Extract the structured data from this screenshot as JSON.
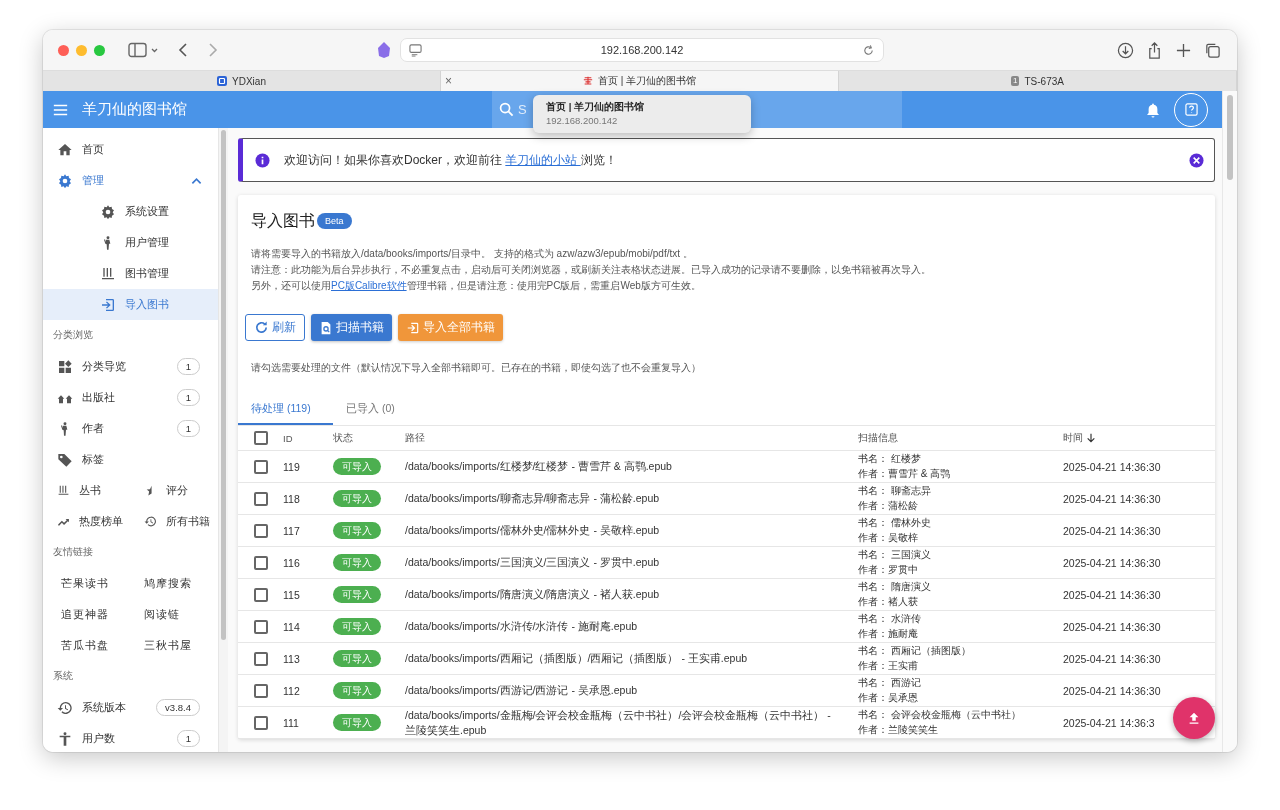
{
  "browser": {
    "address": "192.168.200.142",
    "tabs": [
      {
        "title": "YDXian",
        "selected": false
      },
      {
        "title": "首页 | 羊刀仙的图书馆",
        "selected": true,
        "close": "×"
      },
      {
        "title": "TS-673A",
        "selected": false,
        "badge": "1"
      }
    ],
    "tooltip": {
      "title": "首页 | 羊刀仙的图书馆",
      "url": "192.168.200.142"
    }
  },
  "app": {
    "title": "羊刀仙的图书馆",
    "search": {
      "placeholder": "S"
    }
  },
  "sidebar": {
    "nav": [
      {
        "label": "首页",
        "selected": false
      },
      {
        "label": "管理",
        "selected": false,
        "expanded": true,
        "children": [
          {
            "label": "系统设置",
            "selected": false
          },
          {
            "label": "用户管理",
            "selected": false
          },
          {
            "label": "图书管理",
            "selected": false
          },
          {
            "label": "导入图书",
            "selected": true
          }
        ]
      }
    ],
    "sections": [
      {
        "heading": "分类浏览",
        "items": [
          {
            "label": "分类导览",
            "count": "1"
          },
          {
            "label": "出版社",
            "count": "1"
          },
          {
            "label": "作者",
            "count": "1"
          },
          {
            "label": "标签"
          }
        ],
        "pairs": [
          "丛书",
          "评分",
          "热度榜单",
          "所有书籍"
        ]
      },
      {
        "heading": "友情链接",
        "pairs": [
          "芒果读书",
          "鸠摩搜索",
          "追更神器",
          "阅读链",
          "苦瓜书盘",
          "三秋书屋"
        ]
      },
      {
        "heading": "系统",
        "items": [
          {
            "label": "系统版本",
            "count": "v3.8.4"
          },
          {
            "label": "用户数",
            "count": "1"
          }
        ]
      }
    ]
  },
  "notice": {
    "before": "欢迎访问！如果你喜欢Docker，欢迎前往 ",
    "link": "羊刀仙的小站 ",
    "after": "浏览！"
  },
  "card": {
    "title": "导入图书",
    "badge": "Beta",
    "lines": [
      {
        "text": "请将需要导入的书籍放入/data/books/imports/目录中。 支持的格式为 azw/azw3/epub/mobi/pdf/txt 。"
      },
      {
        "text": "请注意：此功能为后台异步执行，不必重复点击，启动后可关闭浏览器，或刷新关注表格状态进展。已导入成功的记录请不要删除，以免书籍被再次导入。"
      },
      {
        "before": "另外，还可以使用",
        "link": "PC版Calibre软件",
        "after": "管理书籍，但是请注意：使用完PC版后，需重启Web版方可生效。"
      }
    ],
    "buttons": [
      {
        "label": "刷新",
        "kind": "outlined"
      },
      {
        "label": "扫描书籍",
        "kind": "primary"
      },
      {
        "label": "导入全部书籍",
        "kind": "warning"
      }
    ],
    "hint": "请勾选需要处理的文件（默认情况下导入全部书籍即可。已存在的书籍，即使勾选了也不会重复导入）",
    "tabs": [
      {
        "label": "待处理 (119)",
        "selected": true
      },
      {
        "label": "已导入 (0)",
        "selected": false
      }
    ],
    "table": {
      "all_checked": false,
      "columns": [
        "ID",
        "状态",
        "路径",
        "扫描信息",
        "时间"
      ],
      "rows": [
        {
          "checked": false,
          "id": "119",
          "status": "可导入",
          "path": "/data/books/imports/红楼梦/红楼梦 - 曹雪芹 & 高鹗.epub",
          "title_line": "书名：  红楼梦",
          "author_line": "作者：曹雪芹 & 高鹗",
          "time": "2025-04-21 14:36:30"
        },
        {
          "checked": false,
          "id": "118",
          "status": "可导入",
          "path": "/data/books/imports/聊斋志异/聊斋志异 - 蒲松龄.epub",
          "title_line": "书名：  聊斋志异",
          "author_line": "作者：蒲松龄",
          "time": "2025-04-21 14:36:30"
        },
        {
          "checked": false,
          "id": "117",
          "status": "可导入",
          "path": "/data/books/imports/儒林外史/儒林外史 - 吴敬梓.epub",
          "title_line": "书名：  儒林外史",
          "author_line": "作者：吴敬梓",
          "time": "2025-04-21 14:36:30"
        },
        {
          "checked": false,
          "id": "116",
          "status": "可导入",
          "path": "/data/books/imports/三国演义/三国演义 - 罗贯中.epub",
          "title_line": "书名：  三国演义",
          "author_line": "作者：罗贯中",
          "time": "2025-04-21 14:36:30"
        },
        {
          "checked": false,
          "id": "115",
          "status": "可导入",
          "path": "/data/books/imports/隋唐演义/隋唐演义 - 褚人获.epub",
          "title_line": "书名：  隋唐演义",
          "author_line": "作者：褚人获",
          "time": "2025-04-21 14:36:30"
        },
        {
          "checked": false,
          "id": "114",
          "status": "可导入",
          "path": "/data/books/imports/水浒传/水浒传 - 施耐庵.epub",
          "title_line": "书名：  水浒传",
          "author_line": "作者：施耐庵",
          "time": "2025-04-21 14:36:30"
        },
        {
          "checked": false,
          "id": "113",
          "status": "可导入",
          "path": "/data/books/imports/西厢记（插图版）/西厢记（插图版） - 王实甫.epub",
          "title_line": "书名：  西厢记（插图版）",
          "author_line": "作者：王实甫",
          "time": "2025-04-21 14:36:30"
        },
        {
          "checked": false,
          "id": "112",
          "status": "可导入",
          "path": "/data/books/imports/西游记/西游记 - 吴承恩.epub",
          "title_line": "书名：  西游记",
          "author_line": "作者：吴承恩",
          "time": "2025-04-21 14:36:30"
        },
        {
          "checked": false,
          "id": "111",
          "status": "可导入",
          "path": "/data/books/imports/金瓶梅/会评会校金瓶梅（云中书社）/会评会校金瓶梅（云中书社） - 兰陵笑笑生.epub",
          "title_line": "书名：  会评会校金瓶梅（云中书社）",
          "author_line": "作者：兰陵笑笑生",
          "time": "2025-04-21 14:36:3"
        }
      ]
    }
  }
}
